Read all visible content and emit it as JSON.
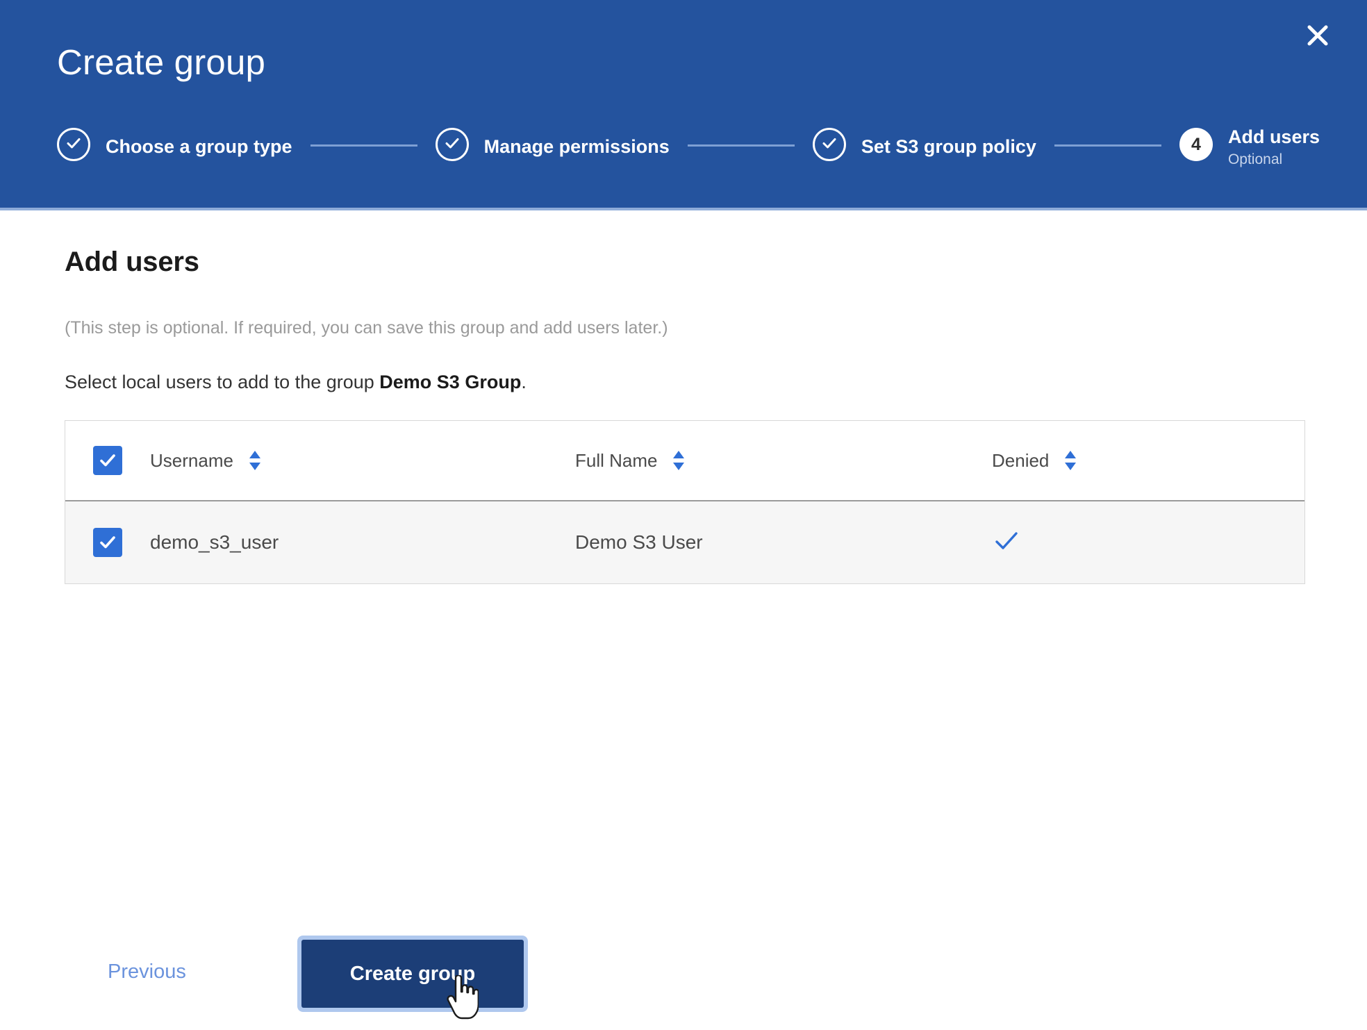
{
  "header": {
    "title": "Create group",
    "close_icon": "close-icon",
    "steps": [
      {
        "label": "Choose a group type",
        "state": "done",
        "marker": "check-icon",
        "sub": ""
      },
      {
        "label": "Manage permissions",
        "state": "done",
        "marker": "check-icon",
        "sub": ""
      },
      {
        "label": "Set S3 group policy",
        "state": "done",
        "marker": "check-icon",
        "sub": ""
      },
      {
        "label": "Add users",
        "state": "current",
        "marker": "4",
        "sub": "Optional"
      }
    ]
  },
  "main": {
    "page_title": "Add users",
    "optional_note": "(This step is optional. If required, you can save this group and add users later.)",
    "select_prefix": "Select local users to add to the group ",
    "group_name": "Demo S3 Group",
    "select_suffix": ".",
    "table": {
      "select_all_checked": true,
      "columns": [
        {
          "label": "Username",
          "sortable": true
        },
        {
          "label": "Full Name",
          "sortable": true
        },
        {
          "label": "Denied",
          "sortable": true
        }
      ],
      "rows": [
        {
          "selected": true,
          "username": "demo_s3_user",
          "full_name": "Demo S3 User",
          "denied": true,
          "denied_icon": "check-icon"
        }
      ]
    }
  },
  "footer": {
    "previous_label": "Previous",
    "create_label": "Create group"
  },
  "colors": {
    "header_blue": "#24539E",
    "header_rule": "#8FACD9",
    "connector": "#7E9FD4",
    "checkbox_blue": "#2F6FD6",
    "denied_check": "#2F6FD6",
    "primary_button": "#1C3E77",
    "focus_ring": "#AFC8EE",
    "link_blue": "#6b93dd",
    "row_bg": "#f6f6f6",
    "muted_text": "#9a9a9a"
  }
}
